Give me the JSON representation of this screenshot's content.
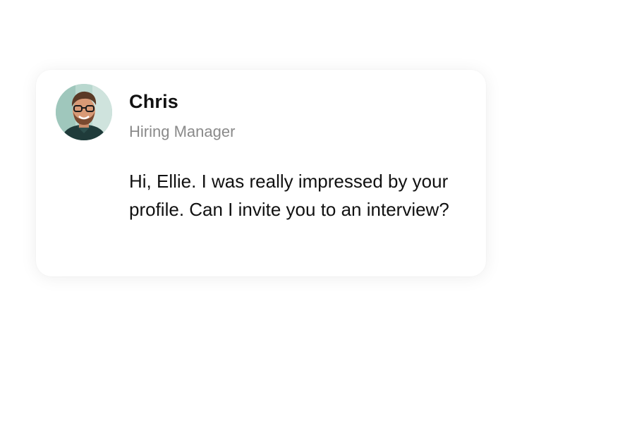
{
  "message_card": {
    "sender": {
      "name": "Chris",
      "role": "Hiring Manager",
      "avatar_icon": "person-avatar-photo"
    },
    "message": "Hi, Ellie. I was really impressed by your profile. Can I invite you to an interview?"
  }
}
